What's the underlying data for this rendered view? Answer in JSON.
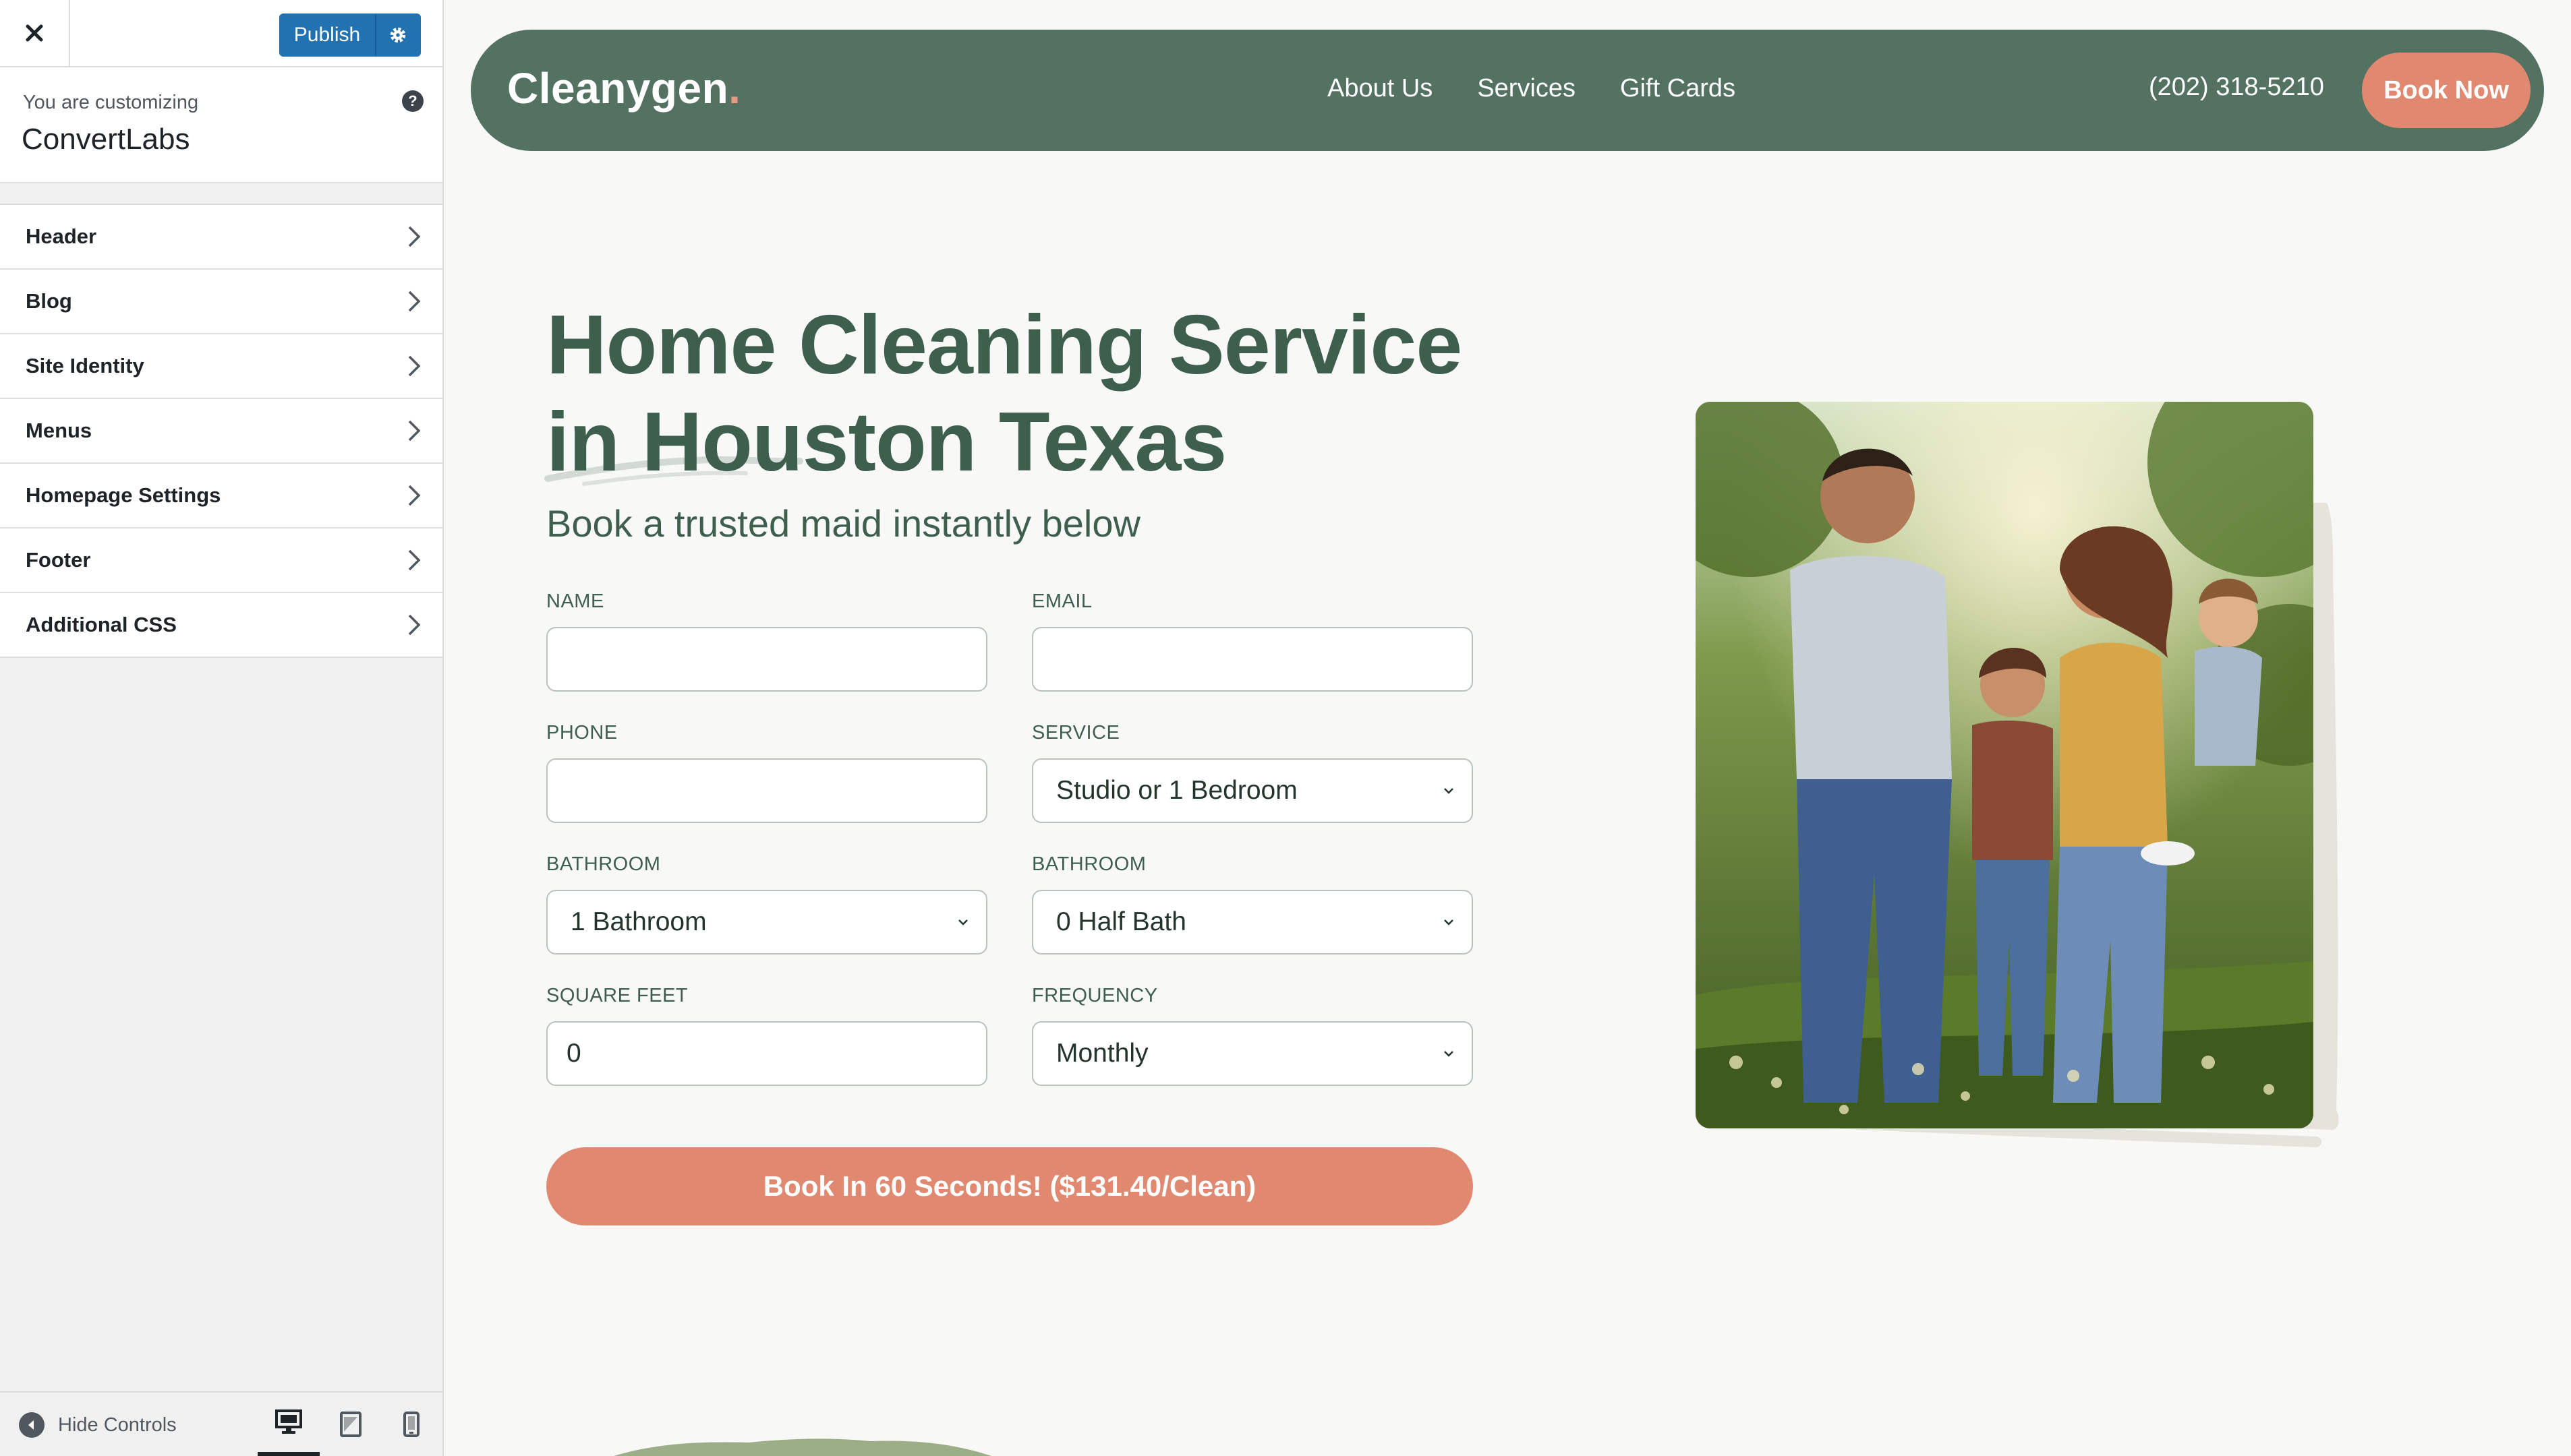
{
  "customizer": {
    "publish_label": "Publish",
    "info_label": "You are customizing",
    "site_name": "ConvertLabs",
    "help_glyph": "?",
    "menu_items": [
      {
        "label": "Header"
      },
      {
        "label": "Blog"
      },
      {
        "label": "Site Identity"
      },
      {
        "label": "Menus"
      },
      {
        "label": "Homepage Settings"
      },
      {
        "label": "Footer"
      },
      {
        "label": "Additional CSS"
      }
    ],
    "hide_controls_label": "Hide Controls",
    "active_device": "desktop",
    "icons": [
      "close-icon",
      "gear-icon",
      "help-icon",
      "chevron-right-icon",
      "collapse-icon",
      "desktop-icon",
      "tablet-icon",
      "mobile-icon"
    ],
    "accent_color": "#2271b1"
  },
  "site": {
    "logo_text": "Cleanygen",
    "logo_dot": ".",
    "nav": [
      {
        "label": "About Us"
      },
      {
        "label": "Services"
      },
      {
        "label": "Gift Cards"
      }
    ],
    "phone": "(202) 318-5210",
    "book_label": "Book Now",
    "header_color": "#547262",
    "accent_color": "#e08870"
  },
  "hero": {
    "title_line1": "Home Cleaning Service",
    "title_line2": "in Houston Texas",
    "subtitle": "Book a trusted maid instantly below"
  },
  "form": {
    "name": {
      "label": "NAME",
      "value": ""
    },
    "email": {
      "label": "EMAIL",
      "value": ""
    },
    "phone": {
      "label": "PHONE",
      "value": ""
    },
    "service": {
      "label": "SERVICE",
      "value": "Studio or 1 Bedroom"
    },
    "bathroom": {
      "label": "BATHROOM",
      "value": "1 Bathroom"
    },
    "half_bath": {
      "label": "BATHROOM",
      "value": "0 Half Bath"
    },
    "square_feet": {
      "label": "SQUARE FEET",
      "value": "0"
    },
    "frequency": {
      "label": "FREQUENCY",
      "value": "Monthly"
    },
    "submit_label": "Book In 60 Seconds! ($131.40/Clean)"
  }
}
